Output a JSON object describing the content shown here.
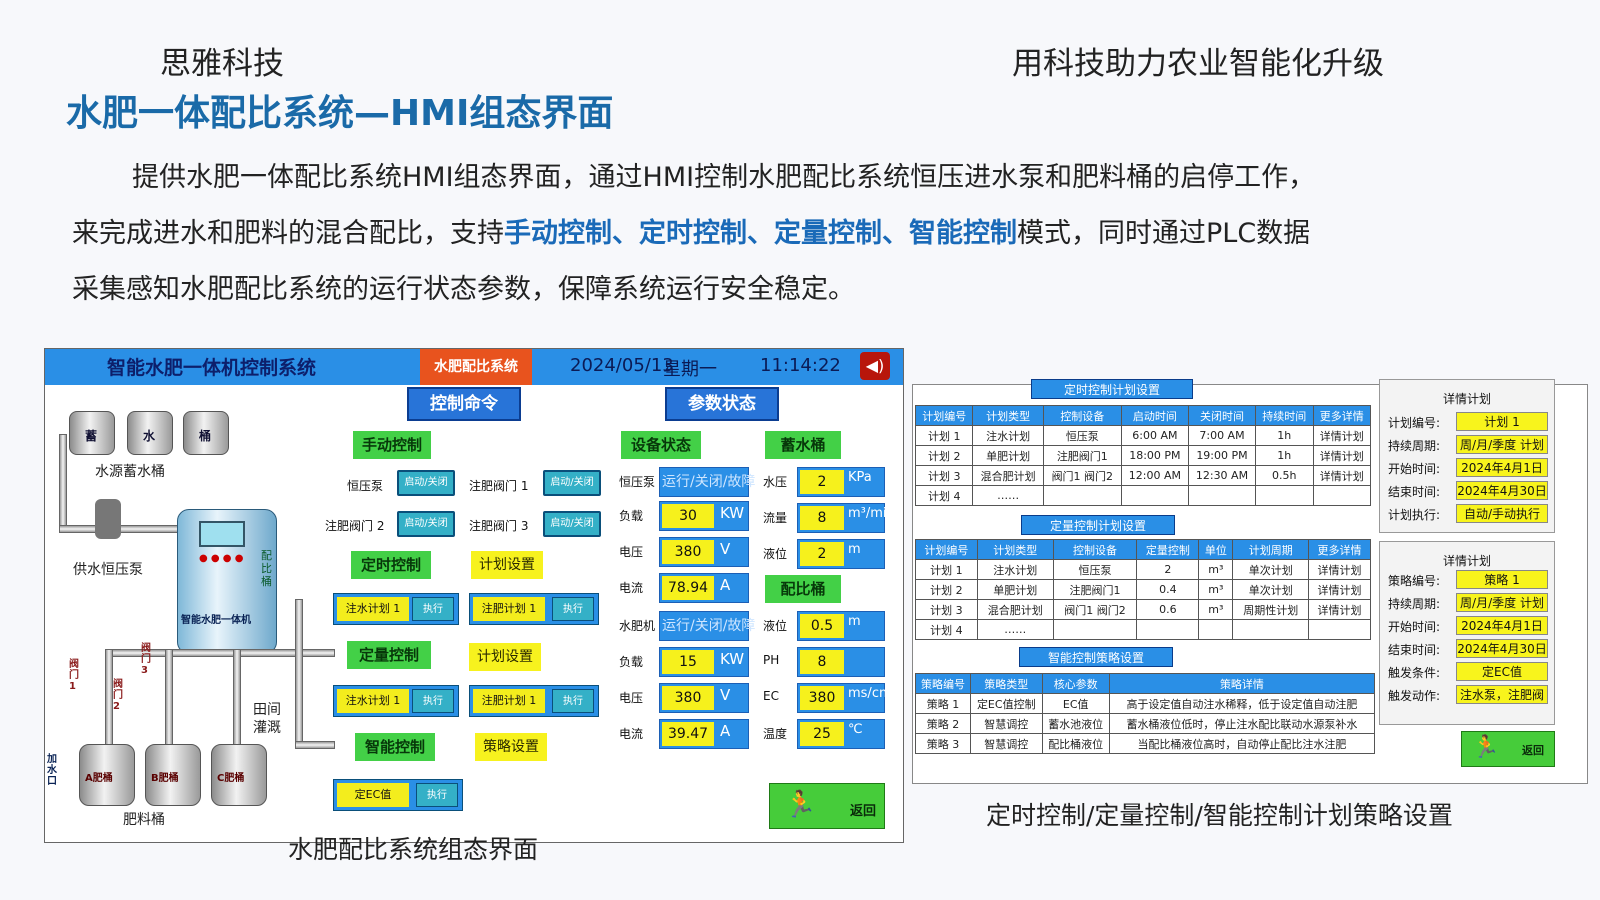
{
  "header": {
    "company": "思雅科技",
    "slogan": "用科技助力农业智能化升级",
    "title": "水肥一体配比系统—HMI组态界面"
  },
  "desc": {
    "p1": "提供水肥一体配比系统HMI组态界面，通过HMI控制水肥配比系统恒压进水泵和肥料桶的启停工作，",
    "p2a": "来完成进水和肥料的混合配比，支持",
    "p2b": "手动控制、定时控制、定量控制、智能控制",
    "p2c": "模式，同时通过PLC数据",
    "p3": "采集感知水肥配比系统的运行状态参数，保障系统运行安全稳定。"
  },
  "captions": {
    "left": "水肥配比系统组态界面",
    "right": "定时控制/定量控制/智能控制计划策略设置"
  },
  "hmi": {
    "title": "智能水肥一体机控制系统",
    "tab": "水肥配比系统",
    "date": "2024/05/13",
    "week": "星期一",
    "time": "11:14:22",
    "cmd_header": "控制命令",
    "param_header": "参数状态",
    "tanks": [
      "蓄",
      "水",
      "桶"
    ],
    "water_tank_label": "水源蓄水桶",
    "pump_label": "供水恒压泵",
    "machine_label": "智能水肥一体机",
    "machine_side": "配比桶",
    "valves": [
      "阀门1",
      "阀门2",
      "阀门3"
    ],
    "fert_tanks": [
      "A肥桶",
      "B肥桶",
      "C肥桶"
    ],
    "fert_label": "肥料桶",
    "field_label": "田间灌溉",
    "inlet_label": "加水口",
    "manual": {
      "title": "手动控制",
      "items": [
        {
          "label": "恒压泵",
          "btn": "启动/关闭"
        },
        {
          "label": "注肥阀门 1",
          "btn": "启动/关闭"
        },
        {
          "label": "注肥阀门 2",
          "btn": "启动/关闭"
        },
        {
          "label": "注肥阀门 3",
          "btn": "启动/关闭"
        }
      ]
    },
    "timed": {
      "title": "定时控制",
      "setting": "计划设置",
      "plans": [
        "注水计划 1",
        "注肥计划 1"
      ],
      "exec": "执行"
    },
    "quant": {
      "title": "定量控制",
      "setting": "计划设置",
      "plans": [
        "注水计划 1",
        "注肥计划 1"
      ],
      "exec": "执行"
    },
    "smart": {
      "title": "智能控制",
      "setting": "策略设置",
      "plan": "定EC值",
      "exec": "执行"
    },
    "device_status": {
      "title": "设备状态",
      "rows": [
        {
          "label": "恒压泵",
          "value": "运行/关闭/故障",
          "unit": ""
        },
        {
          "label": "负载",
          "value": "30",
          "unit": "KW"
        },
        {
          "label": "电压",
          "value": "380",
          "unit": "V"
        },
        {
          "label": "电流",
          "value": "78.94",
          "unit": "A"
        },
        {
          "label": "水肥机",
          "value": "运行/关闭/故障",
          "unit": ""
        },
        {
          "label": "负载",
          "value": "15",
          "unit": "KW"
        },
        {
          "label": "电压",
          "value": "380",
          "unit": "V"
        },
        {
          "label": "电流",
          "value": "39.47",
          "unit": "A"
        }
      ]
    },
    "storage": {
      "title": "蓄水桶",
      "rows": [
        {
          "label": "水压",
          "value": "2",
          "unit": "KPa"
        },
        {
          "label": "流量",
          "value": "8",
          "unit": "m³/min"
        },
        {
          "label": "液位",
          "value": "2",
          "unit": "m"
        }
      ]
    },
    "mixing": {
      "title": "配比桶",
      "rows": [
        {
          "label": "液位",
          "value": "0.5",
          "unit": "m"
        },
        {
          "label": "PH",
          "value": "8",
          "unit": ""
        },
        {
          "label": "EC",
          "value": "380",
          "unit": "ms/cm"
        },
        {
          "label": "温度",
          "value": "25",
          "unit": "℃"
        }
      ]
    },
    "back": "返回"
  },
  "timed_table": {
    "title": "定时控制计划设置",
    "headers": [
      "计划编号",
      "计划类型",
      "控制设备",
      "启动时间",
      "关闭时间",
      "持续时间",
      "更多详情"
    ],
    "rows": [
      [
        "计划 1",
        "注水计划",
        "恒压泵",
        "6:00 AM",
        "7:00 AM",
        "1h",
        "详情计划"
      ],
      [
        "计划 2",
        "单肥计划",
        "注肥阀门1",
        "18:00 PM",
        "19:00 PM",
        "1h",
        "详情计划"
      ],
      [
        "计划 3",
        "混合肥计划",
        "阀门1 阀门2",
        "12:00 AM",
        "12:30 AM",
        "0.5h",
        "详情计划"
      ],
      [
        "计划 4",
        "……",
        "",
        "",
        "",
        "",
        ""
      ]
    ]
  },
  "quant_table": {
    "title": "定量控制计划设置",
    "headers": [
      "计划编号",
      "计划类型",
      "控制设备",
      "定量控制",
      "单位",
      "计划周期",
      "更多详情"
    ],
    "rows": [
      [
        "计划 1",
        "注水计划",
        "恒压泵",
        "2",
        "m³",
        "单次计划",
        "详情计划"
      ],
      [
        "计划 2",
        "单肥计划",
        "注肥阀门1",
        "0.4",
        "m³",
        "单次计划",
        "详情计划"
      ],
      [
        "计划 3",
        "混合肥计划",
        "阀门1 阀门2",
        "0.6",
        "m³",
        "周期性计划",
        "详情计划"
      ],
      [
        "计划 4",
        "……",
        "",
        "",
        "",
        "",
        ""
      ]
    ]
  },
  "smart_table": {
    "title": "智能控制策略设置",
    "headers": [
      "策略编号",
      "策略类型",
      "核心参数",
      "策略详情"
    ],
    "rows": [
      [
        "策略 1",
        "定EC值控制",
        "EC值",
        "高于设定值自动注水稀释，低于设定值自动注肥"
      ],
      [
        "策略 2",
        "智慧调控",
        "蓄水池液位",
        "蓄水桶液位低时，停止注水配比联动水源泵补水"
      ],
      [
        "策略 3",
        "智慧调控",
        "配比桶液位",
        "当配比桶液位高时，自动停止配比注水注肥"
      ]
    ]
  },
  "detail1": {
    "title": "详情计划",
    "rows": [
      {
        "label": "计划编号:",
        "value": "计划 1"
      },
      {
        "label": "持续周期:",
        "value": "周/月/季度 计划"
      },
      {
        "label": "开始时间:",
        "value": "2024年4月1日"
      },
      {
        "label": "结束时间:",
        "value": "2024年4月30日"
      },
      {
        "label": "计划执行:",
        "value": "自动/手动执行"
      }
    ]
  },
  "detail2": {
    "title": "详情计划",
    "rows": [
      {
        "label": "策略编号:",
        "value": "策略 1"
      },
      {
        "label": "持续周期:",
        "value": "周/月/季度 计划"
      },
      {
        "label": "开始时间:",
        "value": "2024年4月1日"
      },
      {
        "label": "结束时间:",
        "value": "2024年4月30日"
      },
      {
        "label": "触发条件:",
        "value": "定EC值"
      },
      {
        "label": "触发动作:",
        "value": "注水泵，注肥阀"
      }
    ]
  },
  "back2": "返回"
}
